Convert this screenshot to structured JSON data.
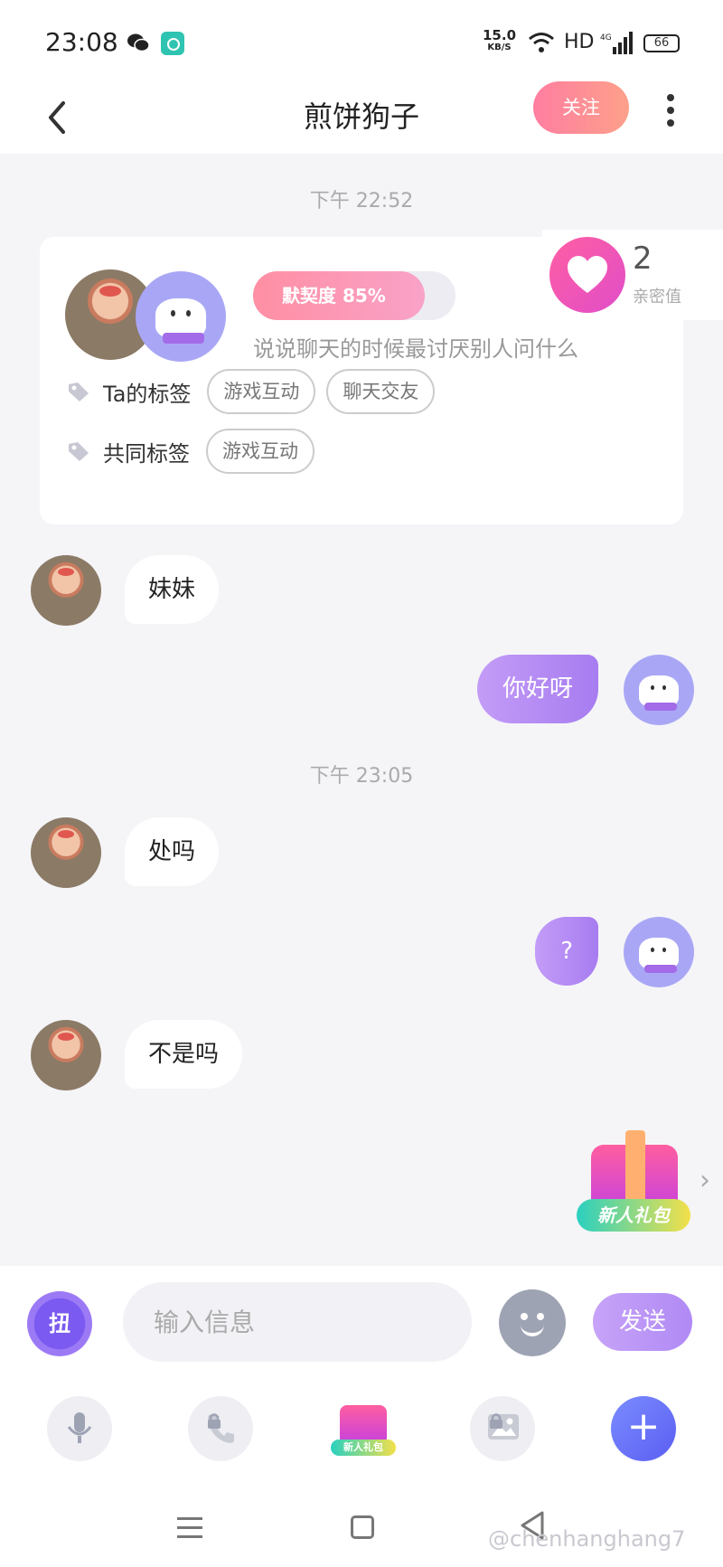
{
  "status_bar": {
    "time": "23:08",
    "net_speed": "15.0",
    "net_unit": "KB/S",
    "hd": "HD",
    "battery": "66"
  },
  "header": {
    "title": "煎饼狗子",
    "follow_label": "关注"
  },
  "chat_start_time": "下午 22:52",
  "profile_card": {
    "tacit_label": "默契度 85%",
    "tacit_percent": 85,
    "prompt": "说说聊天的时候最讨厌别人问什么",
    "their_tags_title": "Ta的标签",
    "their_tags": [
      "游戏互动",
      "聊天交友"
    ],
    "common_tags_title": "共同标签",
    "common_tags": [
      "游戏互动"
    ]
  },
  "intimacy": {
    "value": "2",
    "label": "亲密值"
  },
  "messages": [
    {
      "from": "them",
      "text": "妹妹"
    },
    {
      "from": "me",
      "text": "你好呀"
    },
    {
      "from": "them",
      "text": "处吗"
    },
    {
      "from": "me",
      "text": "?"
    },
    {
      "from": "them",
      "text": "不是吗"
    }
  ],
  "second_time": "下午 23:05",
  "gift_banner": "新人礼包",
  "composer": {
    "spin_label": "扭",
    "placeholder": "输入信息",
    "send_label": "发送",
    "toolbar_gift_label": "新人礼包"
  },
  "watermark": "@chenhanghang7",
  "colors": {
    "accent_purple": "#a77cf0",
    "follow_pink": "#ff7ea1",
    "intimacy_pink": "#ff5fa2"
  }
}
